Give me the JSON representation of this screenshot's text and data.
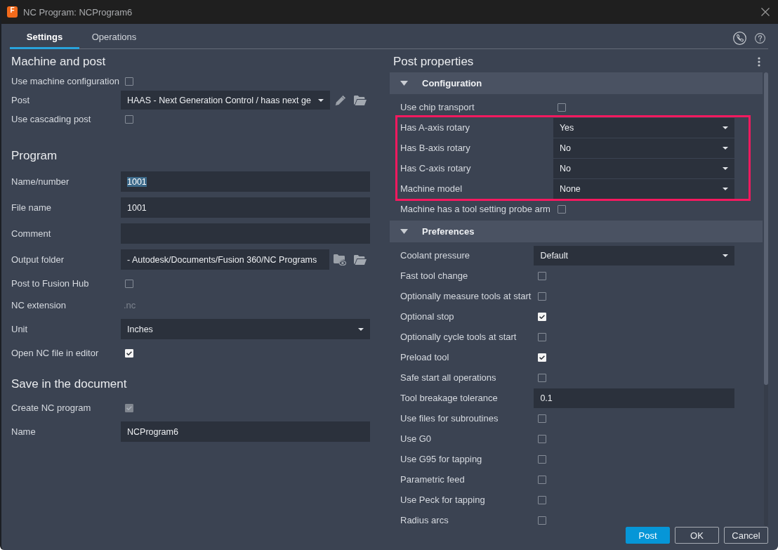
{
  "window": {
    "title": "NC Program: NCProgram6",
    "logo": "F"
  },
  "tabs": [
    {
      "label": "Settings",
      "selected": true
    },
    {
      "label": "Operations",
      "selected": false
    }
  ],
  "settings": {
    "sections": [
      {
        "title": "Machine and post",
        "rows": [
          {
            "kind": "checkbox",
            "label": "Use machine configuration",
            "checked": false,
            "disabled": false
          },
          {
            "kind": "postpicker",
            "label": "Post",
            "value": "HAAS - Next Generation Control / haas next ge"
          },
          {
            "kind": "checkbox",
            "label": "Use cascading post",
            "checked": false,
            "disabled": false
          }
        ]
      },
      {
        "title": "Program",
        "rows": [
          {
            "kind": "text",
            "label": "Name/number",
            "value": "1001",
            "text_selected": true
          },
          {
            "kind": "text",
            "label": "File name",
            "value": "1001",
            "text_selected": false
          },
          {
            "kind": "text",
            "label": "Comment"
          },
          {
            "kind": "folderpicker",
            "label": "Output folder",
            "value": "- Autodesk/Documents/Fusion 360/NC Programs"
          },
          {
            "kind": "checkbox",
            "label": "Post to Fusion Hub",
            "checked": false,
            "disabled": false
          },
          {
            "kind": "readonly",
            "label": "NC extension",
            "value": ".nc"
          },
          {
            "kind": "dropdown",
            "label": "Unit",
            "value": "Inches"
          },
          {
            "kind": "checkbox",
            "label": "Open NC file in editor",
            "checked": true,
            "disabled": false
          }
        ]
      },
      {
        "title": "Save in the document",
        "rows": [
          {
            "kind": "checkbox",
            "label": "Create NC program",
            "checked": true,
            "disabled": true
          },
          {
            "kind": "text",
            "label": "Name",
            "value": "NCProgram6",
            "text_selected": false
          }
        ]
      }
    ]
  },
  "post_properties": {
    "title": "Post properties",
    "sections": [
      {
        "title": "Configuration",
        "expanded": true,
        "items": [
          {
            "kind": "checkbox",
            "label": "Use chip transport",
            "checked": false,
            "highlighted": false
          },
          {
            "kind": "dropdown",
            "label": "Has A-axis rotary",
            "value": "Yes",
            "highlighted": true
          },
          {
            "kind": "dropdown",
            "label": "Has B-axis rotary",
            "value": "No",
            "highlighted": true
          },
          {
            "kind": "dropdown",
            "label": "Has C-axis rotary",
            "value": "No",
            "highlighted": true
          },
          {
            "kind": "dropdown",
            "label": "Machine model",
            "value": "None",
            "highlighted": true
          },
          {
            "kind": "checkbox",
            "label": "Machine has a tool setting probe arm",
            "checked": false,
            "highlighted": false
          }
        ]
      },
      {
        "title": "Preferences",
        "expanded": true,
        "items": [
          {
            "kind": "dropdown",
            "label": "Coolant pressure",
            "value": "Default",
            "highlighted": false
          },
          {
            "kind": "checkbox",
            "label": "Fast tool change",
            "checked": false,
            "highlighted": false
          },
          {
            "kind": "checkbox",
            "label": "Optionally measure tools at start",
            "checked": false,
            "highlighted": false
          },
          {
            "kind": "checkbox",
            "label": "Optional stop",
            "checked": true,
            "highlighted": false
          },
          {
            "kind": "checkbox",
            "label": "Optionally cycle tools at start",
            "checked": false,
            "highlighted": false
          },
          {
            "kind": "checkbox",
            "label": "Preload tool",
            "checked": true,
            "highlighted": false
          },
          {
            "kind": "checkbox",
            "label": "Safe start all operations",
            "checked": false,
            "highlighted": false
          },
          {
            "kind": "text",
            "label": "Tool breakage tolerance",
            "value": "0.1",
            "highlighted": false
          },
          {
            "kind": "checkbox",
            "label": "Use files for subroutines",
            "checked": false,
            "highlighted": false
          },
          {
            "kind": "checkbox",
            "label": "Use G0",
            "checked": false,
            "highlighted": false
          },
          {
            "kind": "checkbox",
            "label": "Use G95 for tapping",
            "checked": false,
            "highlighted": false
          },
          {
            "kind": "checkbox",
            "label": "Parametric feed",
            "checked": false,
            "highlighted": false
          },
          {
            "kind": "checkbox",
            "label": "Use Peck for tapping",
            "checked": false,
            "highlighted": false
          },
          {
            "kind": "checkbox",
            "label": "Radius arcs",
            "checked": false,
            "highlighted": false
          }
        ]
      }
    ]
  },
  "buttons": [
    {
      "label": "Post",
      "kind": "primary"
    },
    {
      "label": "OK",
      "kind": "secondary"
    },
    {
      "label": "Cancel",
      "kind": "secondary"
    }
  ]
}
